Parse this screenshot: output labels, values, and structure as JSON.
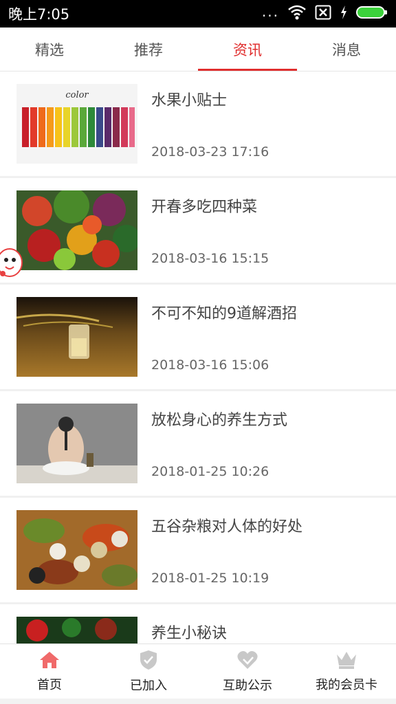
{
  "status_bar": {
    "time": "晚上7:05",
    "dots": "...",
    "icons": [
      "wifi-icon",
      "sim-x-icon",
      "charging-icon",
      "battery-icon"
    ]
  },
  "tabs": [
    {
      "label": "精选",
      "active": false
    },
    {
      "label": "推荐",
      "active": false
    },
    {
      "label": "资讯",
      "active": true
    },
    {
      "label": "消息",
      "active": false
    }
  ],
  "news": [
    {
      "title": "水果小贴士",
      "date": "2018-03-23 17:16",
      "thumb_text": "color"
    },
    {
      "title": "开春多吃四种菜",
      "date": "2018-03-16 15:15"
    },
    {
      "title": "不可不知的9道解酒招",
      "date": "2018-03-16 15:06"
    },
    {
      "title": "放松身心的养生方式",
      "date": "2018-01-25 10:26"
    },
    {
      "title": "五谷杂粮对人体的好处",
      "date": "2018-01-25 10:19"
    },
    {
      "title": "养生小秘诀",
      "date": ""
    }
  ],
  "bottom_nav": [
    {
      "label": "首页",
      "icon": "home-icon",
      "active": true
    },
    {
      "label": "已加入",
      "icon": "shield-check-icon",
      "active": false
    },
    {
      "label": "互助公示",
      "icon": "heart-hands-icon",
      "active": false
    },
    {
      "label": "我的会员卡",
      "icon": "crown-icon",
      "active": false
    }
  ],
  "colors": {
    "accent": "#e02e2e",
    "home_icon": "#f06a6a",
    "inactive_icon": "#c8c8c8"
  }
}
